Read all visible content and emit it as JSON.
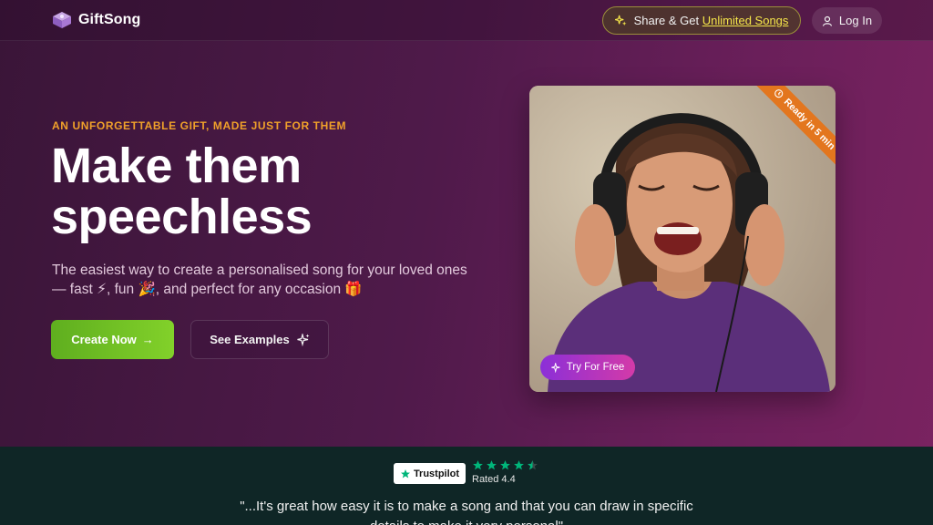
{
  "nav": {
    "brand": "GiftSong",
    "share_prefix": "Share & Get ",
    "share_highlight": "Unlimited Songs",
    "login_label": "Log In"
  },
  "hero": {
    "eyebrow": "AN UNFORGETTABLE GIFT, MADE JUST FOR THEM",
    "headline_line1": "Make them",
    "headline_line2": "speechless",
    "subtitle": "The easiest way to create a personalised song for your loved ones — fast ⚡, fun 🎉, and perfect for any occasion 🎁",
    "create_label": "Create Now",
    "create_arrow": "→",
    "examples_label": "See Examples"
  },
  "photo_card": {
    "ribbon_label": "Ready in 5 min",
    "try_label": "Try For Free"
  },
  "review": {
    "badge_label": "Trustpilot",
    "rating": 4.4,
    "rated_label": "Rated 4.4",
    "quote": "\"...It's great how easy it is to make a song and that you can draw in specific details to make it very personal\""
  },
  "colors": {
    "accent_orange": "#f0a12a",
    "cta_green": "#6fbf24",
    "star_green": "#00b67a",
    "highlight_yellow": "#f5e64a"
  }
}
